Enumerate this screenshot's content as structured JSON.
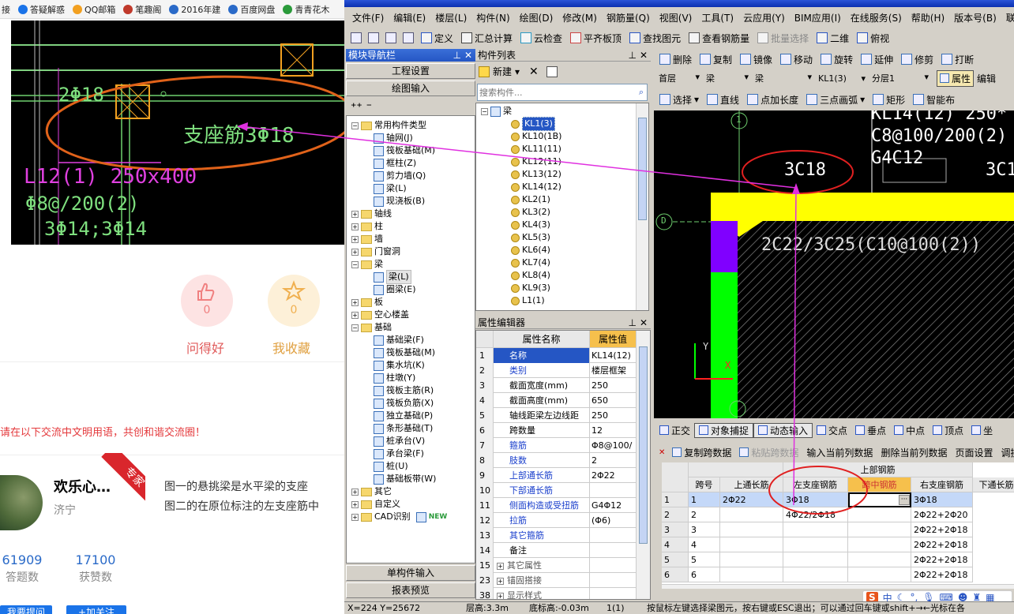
{
  "browser": {
    "bookmarks": [
      {
        "label": "接",
        "icon": "none"
      },
      {
        "label": "答疑解惑",
        "icon": "qa-icon"
      },
      {
        "label": "QQ邮箱",
        "icon": "qq-mail-icon"
      },
      {
        "label": "笔趣阁",
        "icon": "book-icon"
      },
      {
        "label": "2016年建",
        "icon": "paw-icon"
      },
      {
        "label": "百度网盘",
        "icon": "cloud-icon"
      },
      {
        "label": "青青花木",
        "icon": "leaf-icon"
      }
    ],
    "cad_image": {
      "top_label": "2Φ18",
      "support_label": "支座筋3Φ18",
      "beam_label": "L12(1) 250x400",
      "stirrup_label": "Φ8@/200(2)",
      "bottom_label": "3Φ14;3Φ14"
    },
    "votes": [
      {
        "label": "问得好",
        "count": "0"
      },
      {
        "label": "我收藏",
        "count": "0"
      }
    ],
    "rules_text": "请在以下交流中文明用语，共创和谐交流圈！",
    "user": {
      "name": "欢乐心…",
      "location": "济宁",
      "badge": "专家"
    },
    "answer_lines": [
      "图一的悬挑梁是水平梁的支座",
      "图二的在原位标注的左支座筋中"
    ],
    "stats": [
      {
        "value": "61909",
        "label": "答题数"
      },
      {
        "value": "17100",
        "label": "获赞数"
      }
    ],
    "bottom_buttons": [
      "我要提问",
      "+加关注"
    ]
  },
  "app": {
    "menu": [
      "文件(F)",
      "编辑(E)",
      "楼层(L)",
      "构件(N)",
      "绘图(D)",
      "修改(M)",
      "钢筋量(Q)",
      "视图(V)",
      "工具(T)",
      "云应用(Y)",
      "BIM应用(I)",
      "在线服务(S)",
      "帮助(H)",
      "版本号(B)",
      "联系"
    ],
    "toolbar": [
      "定义",
      "汇总计算",
      "云检查",
      "平齐板顶",
      "查找图元",
      "查看钢筋量",
      "批量选择",
      "二维",
      "俯视"
    ],
    "nav_panel": {
      "title": "模块导航栏",
      "buttons": [
        "工程设置",
        "绘图输入"
      ],
      "tree": [
        {
          "label": "常用构件类型",
          "level": 0,
          "type": "folder",
          "open": true
        },
        {
          "label": "轴网(J)",
          "level": 1,
          "type": "item"
        },
        {
          "label": "筏板基础(M)",
          "level": 1,
          "type": "item"
        },
        {
          "label": "框柱(Z)",
          "level": 1,
          "type": "item"
        },
        {
          "label": "剪力墙(Q)",
          "level": 1,
          "type": "item"
        },
        {
          "label": "梁(L)",
          "level": 1,
          "type": "item"
        },
        {
          "label": "现浇板(B)",
          "level": 1,
          "type": "item"
        },
        {
          "label": "轴线",
          "level": 0,
          "type": "folder",
          "open": false
        },
        {
          "label": "柱",
          "level": 0,
          "type": "folder",
          "open": false
        },
        {
          "label": "墙",
          "level": 0,
          "type": "folder",
          "open": false
        },
        {
          "label": "门窗洞",
          "level": 0,
          "type": "folder",
          "open": false
        },
        {
          "label": "梁",
          "level": 0,
          "type": "folder",
          "open": true
        },
        {
          "label": "梁(L)",
          "level": 1,
          "type": "item"
        },
        {
          "label": "圈梁(E)",
          "level": 1,
          "type": "item"
        },
        {
          "label": "板",
          "level": 0,
          "type": "folder",
          "open": false
        },
        {
          "label": "空心楼盖",
          "level": 0,
          "type": "folder",
          "open": false
        },
        {
          "label": "基础",
          "level": 0,
          "type": "folder",
          "open": true
        },
        {
          "label": "基础梁(F)",
          "level": 1,
          "type": "item"
        },
        {
          "label": "筏板基础(M)",
          "level": 1,
          "type": "item"
        },
        {
          "label": "集水坑(K)",
          "level": 1,
          "type": "item"
        },
        {
          "label": "柱墩(Y)",
          "level": 1,
          "type": "item"
        },
        {
          "label": "筏板主筋(R)",
          "level": 1,
          "type": "item"
        },
        {
          "label": "筏板负筋(X)",
          "level": 1,
          "type": "item"
        },
        {
          "label": "独立基础(P)",
          "level": 1,
          "type": "item"
        },
        {
          "label": "条形基础(T)",
          "level": 1,
          "type": "item"
        },
        {
          "label": "桩承台(V)",
          "level": 1,
          "type": "item"
        },
        {
          "label": "承台梁(F)",
          "level": 1,
          "type": "item"
        },
        {
          "label": "桩(U)",
          "level": 1,
          "type": "item"
        },
        {
          "label": "基础板带(W)",
          "level": 1,
          "type": "item"
        },
        {
          "label": "其它",
          "level": 0,
          "type": "folder",
          "open": false
        },
        {
          "label": "自定义",
          "level": 0,
          "type": "folder",
          "open": false
        },
        {
          "label": "CAD识别",
          "level": 0,
          "type": "folder",
          "open": false
        }
      ],
      "new_badge": "NEW",
      "bottom_buttons": [
        "单构件输入",
        "报表预览"
      ]
    },
    "component_panel": {
      "title": "构件列表",
      "new_label": "新建",
      "search_placeholder": "搜索构件...",
      "root": "梁",
      "items": [
        "KL1(3)",
        "KL10(1B)",
        "KL11(11)",
        "KL12(11)",
        "KL13(12)",
        "KL14(12)",
        "KL2(1)",
        "KL3(2)",
        "KL4(3)",
        "KL5(3)",
        "KL6(4)",
        "KL7(4)",
        "KL8(4)",
        "KL9(3)",
        "L1(1)"
      ]
    },
    "property_panel": {
      "title": "属性编辑器",
      "col_name": "属性名称",
      "col_value": "属性值",
      "rows": [
        {
          "n": "1",
          "k": "名称",
          "v": "KL14(12)",
          "blue": true
        },
        {
          "n": "2",
          "k": "类别",
          "v": "楼层框架",
          "blue": true
        },
        {
          "n": "3",
          "k": "截面宽度(mm)",
          "v": "250",
          "blue": false
        },
        {
          "n": "4",
          "k": "截面高度(mm)",
          "v": "650",
          "blue": false
        },
        {
          "n": "5",
          "k": "轴线距梁左边线距",
          "v": "250",
          "blue": false
        },
        {
          "n": "6",
          "k": "跨数量",
          "v": "12",
          "blue": false
        },
        {
          "n": "7",
          "k": "箍筋",
          "v": "Φ8@100/",
          "blue": true
        },
        {
          "n": "8",
          "k": "肢数",
          "v": "2",
          "blue": true
        },
        {
          "n": "9",
          "k": "上部通长筋",
          "v": "2Φ22",
          "blue": true
        },
        {
          "n": "10",
          "k": "下部通长筋",
          "v": "",
          "blue": true
        },
        {
          "n": "11",
          "k": "侧面构造或受扭筋",
          "v": "G4Φ12",
          "blue": true
        },
        {
          "n": "12",
          "k": "拉筋",
          "v": "(Φ6)",
          "blue": true
        },
        {
          "n": "13",
          "k": "其它箍筋",
          "v": "",
          "blue": true
        },
        {
          "n": "14",
          "k": "备注",
          "v": "",
          "blue": false
        },
        {
          "n": "15",
          "k": "其它属性",
          "v": "",
          "blue": false
        },
        {
          "n": "23",
          "k": "锚固搭接",
          "v": "",
          "blue": false
        },
        {
          "n": "38",
          "k": "显示样式",
          "v": "",
          "blue": false
        }
      ]
    },
    "edit_toolbar": [
      "删除",
      "复制",
      "镜像",
      "移动",
      "旋转",
      "延伸",
      "修剪",
      "打断"
    ],
    "selectors": [
      "首层",
      "梁",
      "梁",
      "KL1(3)",
      "分层1"
    ],
    "property_toggle": "属性",
    "edit_label": "编辑",
    "draw_toolbar": [
      "选择",
      "直线",
      "点加长度",
      "三点画弧",
      "矩形",
      "智能布"
    ],
    "cad_view": {
      "label_a": "KL14(12) 250*",
      "label_b": "C8@100/200(2)",
      "label_c": "G4C12",
      "circle_label": "3C18",
      "right_label": "3C1",
      "beam_label": "2C22/3C25(C10@100(2))",
      "axis_1": "1",
      "axis_d": "D",
      "axis_y": "Y",
      "axis_x": "X"
    },
    "snap_bar": [
      "正交",
      "对象捕捉",
      "动态输入",
      "交点",
      "垂点",
      "中点",
      "顶点",
      "坐"
    ],
    "table_toolbar": [
      "复制跨数据",
      "粘贴跨数据",
      "输入当前列数据",
      "删除当前列数据",
      "页面设置",
      "调换"
    ],
    "table": {
      "group_header": "上部钢筋",
      "headers": [
        "跨号",
        "上通长筋",
        "左支座钢筋",
        "跨中钢筋",
        "右支座钢筋",
        "下通长筋"
      ],
      "rows": [
        [
          "1",
          "1",
          "2Φ22",
          "3Φ18",
          "",
          "3Φ18"
        ],
        [
          "2",
          "2",
          "",
          "4Φ22/2Φ18",
          "",
          "2Φ22+2Φ20"
        ],
        [
          "3",
          "3",
          "",
          "",
          "",
          "2Φ22+2Φ18"
        ],
        [
          "4",
          "4",
          "",
          "",
          "",
          "2Φ22+2Φ18"
        ],
        [
          "5",
          "5",
          "",
          "",
          "",
          "2Φ22+2Φ18"
        ],
        [
          "6",
          "6",
          "",
          "",
          "",
          "2Φ22+2Φ18"
        ]
      ]
    },
    "ime_label": "中",
    "status": {
      "coords": "X=224 Y=25672",
      "floor_height": "层高:3.3m",
      "base_elev": "底标高:-0.03m",
      "count": "1(1)",
      "hint": "按鼠标左键选择梁图元，按右键或ESC退出；可以通过回车键或shift+→←光标在各"
    }
  },
  "colors": {
    "accent_blue": "#2556c4",
    "annotation_red": "#e02020",
    "annotation_magenta": "#d030d0",
    "cad_yellow": "#ffff00",
    "cad_purple": "#8000ff",
    "cad_green": "#00ff00"
  }
}
